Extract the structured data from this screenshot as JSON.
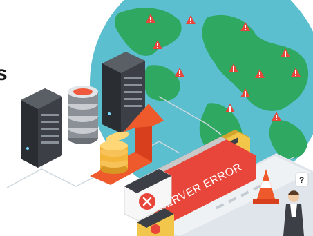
{
  "heading_fragment": "s",
  "error_banner": "SERVER ERROR",
  "bubble_mark": "?",
  "colors": {
    "ocean": "#5bbfcf",
    "land": "#2fa862",
    "alert": "#e8463a",
    "coin": "#f4b53b",
    "server": "#3c4046",
    "arrow": "#ef5a2d",
    "window": "#f2c64a",
    "laptop": "#e9eef3"
  }
}
